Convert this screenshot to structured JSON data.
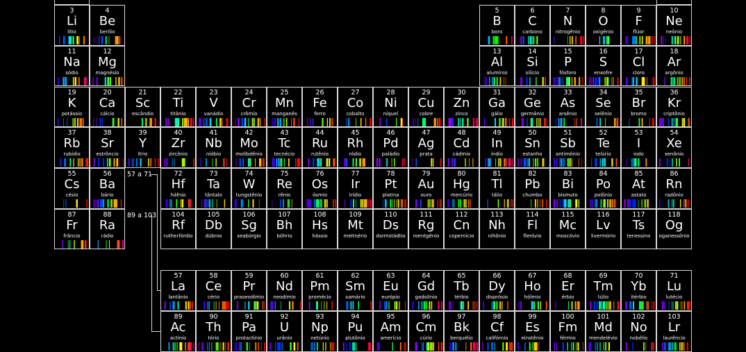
{
  "elements": [
    {
      "n": "3",
      "s": "Li",
      "name": "lítio",
      "c": 1,
      "r": 1,
      "hue": 0
    },
    {
      "n": "4",
      "s": "Be",
      "name": "berílio",
      "c": 2,
      "r": 1,
      "hue": 1
    },
    {
      "n": "5",
      "s": "B",
      "name": "boro",
      "c": 13,
      "r": 1,
      "hue": 2
    },
    {
      "n": "6",
      "s": "C",
      "name": "carbono",
      "c": 14,
      "r": 1,
      "hue": 3
    },
    {
      "n": "7",
      "s": "N",
      "name": "nitrogênio",
      "c": 15,
      "r": 1,
      "hue": 4
    },
    {
      "n": "8",
      "s": "O",
      "name": "oxigênio",
      "c": 16,
      "r": 1,
      "hue": 5
    },
    {
      "n": "9",
      "s": "F",
      "name": "flúor",
      "c": 17,
      "r": 1,
      "hue": 6
    },
    {
      "n": "10",
      "s": "Ne",
      "name": "neônio",
      "c": 18,
      "r": 1,
      "hue": 7
    },
    {
      "n": "11",
      "s": "Na",
      "name": "sódio",
      "c": 1,
      "r": 2,
      "hue": 2
    },
    {
      "n": "12",
      "s": "Mg",
      "name": "magnésio",
      "c": 2,
      "r": 2,
      "hue": 3
    },
    {
      "n": "13",
      "s": "Al",
      "name": "alumínio",
      "c": 13,
      "r": 2,
      "hue": 4
    },
    {
      "n": "14",
      "s": "Si",
      "name": "silício",
      "c": 14,
      "r": 2,
      "hue": 5
    },
    {
      "n": "15",
      "s": "P",
      "name": "fósforo",
      "c": 15,
      "r": 2,
      "hue": 6
    },
    {
      "n": "16",
      "s": "S",
      "name": "enxofre",
      "c": 16,
      "r": 2,
      "hue": 7
    },
    {
      "n": "17",
      "s": "Cl",
      "name": "cloro",
      "c": 17,
      "r": 2,
      "hue": 0
    },
    {
      "n": "18",
      "s": "Ar",
      "name": "argônio",
      "c": 18,
      "r": 2,
      "hue": 1
    },
    {
      "n": "19",
      "s": "K",
      "name": "potássio",
      "c": 1,
      "r": 3,
      "hue": 4
    },
    {
      "n": "20",
      "s": "Ca",
      "name": "cálcio",
      "c": 2,
      "r": 3,
      "hue": 5
    },
    {
      "n": "21",
      "s": "Sc",
      "name": "escândio",
      "c": 3,
      "r": 3,
      "hue": 6
    },
    {
      "n": "22",
      "s": "Ti",
      "name": "titânio",
      "c": 4,
      "r": 3,
      "hue": 7
    },
    {
      "n": "23",
      "s": "V",
      "name": "vanádio",
      "c": 5,
      "r": 3,
      "hue": 0
    },
    {
      "n": "24",
      "s": "Cr",
      "name": "crômio",
      "c": 6,
      "r": 3,
      "hue": 1
    },
    {
      "n": "25",
      "s": "Mn",
      "name": "manganês",
      "c": 7,
      "r": 3,
      "hue": 2
    },
    {
      "n": "26",
      "s": "Fe",
      "name": "ferro",
      "c": 8,
      "r": 3,
      "hue": 3
    },
    {
      "n": "27",
      "s": "Co",
      "name": "cobalto",
      "c": 9,
      "r": 3,
      "hue": 4
    },
    {
      "n": "28",
      "s": "Ni",
      "name": "níquel",
      "c": 10,
      "r": 3,
      "hue": 5
    },
    {
      "n": "29",
      "s": "Cu",
      "name": "cobre",
      "c": 11,
      "r": 3,
      "hue": 6
    },
    {
      "n": "30",
      "s": "Zn",
      "name": "zinco",
      "c": 12,
      "r": 3,
      "hue": 7
    },
    {
      "n": "31",
      "s": "Ga",
      "name": "gálio",
      "c": 13,
      "r": 3,
      "hue": 0
    },
    {
      "n": "32",
      "s": "Ge",
      "name": "germânio",
      "c": 14,
      "r": 3,
      "hue": 1
    },
    {
      "n": "33",
      "s": "As",
      "name": "arsênio",
      "c": 15,
      "r": 3,
      "hue": 2
    },
    {
      "n": "34",
      "s": "Se",
      "name": "selênio",
      "c": 16,
      "r": 3,
      "hue": 3
    },
    {
      "n": "35",
      "s": "Br",
      "name": "bromo",
      "c": 17,
      "r": 3,
      "hue": 4
    },
    {
      "n": "36",
      "s": "Kr",
      "name": "criptônio",
      "c": 18,
      "r": 3,
      "hue": 5
    },
    {
      "n": "37",
      "s": "Rb",
      "name": "rubídio",
      "c": 1,
      "r": 4,
      "hue": 6
    },
    {
      "n": "38",
      "s": "Sr",
      "name": "estrôncio",
      "c": 2,
      "r": 4,
      "hue": 7
    },
    {
      "n": "39",
      "s": "Y",
      "name": "ítrio",
      "c": 3,
      "r": 4,
      "hue": 0
    },
    {
      "n": "40",
      "s": "Zr",
      "name": "zircônio",
      "c": 4,
      "r": 4,
      "hue": 1
    },
    {
      "n": "41",
      "s": "Nb",
      "name": "nióbio",
      "c": 5,
      "r": 4,
      "hue": 2
    },
    {
      "n": "42",
      "s": "Mo",
      "name": "molibdênio",
      "c": 6,
      "r": 4,
      "hue": 3
    },
    {
      "n": "43",
      "s": "Tc",
      "name": "tecnécio",
      "c": 7,
      "r": 4,
      "hue": 4
    },
    {
      "n": "44",
      "s": "Ru",
      "name": "rutênio",
      "c": 8,
      "r": 4,
      "hue": 5
    },
    {
      "n": "45",
      "s": "Rh",
      "name": "ródio",
      "c": 9,
      "r": 4,
      "hue": 6
    },
    {
      "n": "46",
      "s": "Pd",
      "name": "paládio",
      "c": 10,
      "r": 4,
      "hue": 7
    },
    {
      "n": "47",
      "s": "Ag",
      "name": "prata",
      "c": 11,
      "r": 4,
      "hue": 0
    },
    {
      "n": "48",
      "s": "Cd",
      "name": "cádmio",
      "c": 12,
      "r": 4,
      "hue": 1
    },
    {
      "n": "49",
      "s": "In",
      "name": "índio",
      "c": 13,
      "r": 4,
      "hue": 2
    },
    {
      "n": "50",
      "s": "Sn",
      "name": "estanho",
      "c": 14,
      "r": 4,
      "hue": 3
    },
    {
      "n": "51",
      "s": "Sb",
      "name": "antimônio",
      "c": 15,
      "r": 4,
      "hue": 4
    },
    {
      "n": "52",
      "s": "Te",
      "name": "telúrio",
      "c": 16,
      "r": 4,
      "hue": 5
    },
    {
      "n": "53",
      "s": "I",
      "name": "iodo",
      "c": 17,
      "r": 4,
      "hue": 6
    },
    {
      "n": "54",
      "s": "Xe",
      "name": "xenônio",
      "c": 18,
      "r": 4,
      "hue": 7
    },
    {
      "n": "55",
      "s": "Cs",
      "name": "césio",
      "c": 1,
      "r": 5,
      "hue": 0
    },
    {
      "n": "56",
      "s": "Ba",
      "name": "bário",
      "c": 2,
      "r": 5,
      "hue": 1
    },
    {
      "n": "72",
      "s": "Hf",
      "name": "háfnio",
      "c": 4,
      "r": 5,
      "hue": 2
    },
    {
      "n": "73",
      "s": "Ta",
      "name": "tântalo",
      "c": 5,
      "r": 5,
      "hue": 3
    },
    {
      "n": "74",
      "s": "W",
      "name": "tungstênio",
      "c": 6,
      "r": 5,
      "hue": 4
    },
    {
      "n": "75",
      "s": "Re",
      "name": "rênio",
      "c": 7,
      "r": 5,
      "hue": 5
    },
    {
      "n": "76",
      "s": "Os",
      "name": "ósmio",
      "c": 8,
      "r": 5,
      "hue": 6
    },
    {
      "n": "77",
      "s": "Ir",
      "name": "irídio",
      "c": 9,
      "r": 5,
      "hue": 7
    },
    {
      "n": "78",
      "s": "Pt",
      "name": "platina",
      "c": 10,
      "r": 5,
      "hue": 0
    },
    {
      "n": "79",
      "s": "Au",
      "name": "ouro",
      "c": 11,
      "r": 5,
      "hue": 1
    },
    {
      "n": "80",
      "s": "Hg",
      "name": "mercúrio",
      "c": 12,
      "r": 5,
      "hue": 2
    },
    {
      "n": "81",
      "s": "Tl",
      "name": "tálio",
      "c": 13,
      "r": 5,
      "hue": 3
    },
    {
      "n": "82",
      "s": "Pb",
      "name": "chumbo",
      "c": 14,
      "r": 5,
      "hue": 4
    },
    {
      "n": "83",
      "s": "Bi",
      "name": "bismuto",
      "c": 15,
      "r": 5,
      "hue": 5
    },
    {
      "n": "84",
      "s": "Po",
      "name": "polônio",
      "c": 16,
      "r": 5,
      "hue": 6
    },
    {
      "n": "85",
      "s": "At",
      "name": "astato",
      "c": 17,
      "r": 5,
      "hue": 7
    },
    {
      "n": "86",
      "s": "Rn",
      "name": "radônio",
      "c": 18,
      "r": 5,
      "hue": 0
    },
    {
      "n": "87",
      "s": "Fr",
      "name": "frâncio",
      "c": 1,
      "r": 6,
      "hue": 1
    },
    {
      "n": "88",
      "s": "Ra",
      "name": "rádio",
      "c": 2,
      "r": 6,
      "hue": 2
    },
    {
      "n": "104",
      "s": "Rf",
      "name": "rutherfórdio",
      "c": 4,
      "r": 6,
      "hue": -1
    },
    {
      "n": "105",
      "s": "Db",
      "name": "dúbnio",
      "c": 5,
      "r": 6,
      "hue": -1
    },
    {
      "n": "106",
      "s": "Sg",
      "name": "seabórgio",
      "c": 6,
      "r": 6,
      "hue": -1
    },
    {
      "n": "107",
      "s": "Bh",
      "name": "bóhrio",
      "c": 7,
      "r": 6,
      "hue": -1
    },
    {
      "n": "108",
      "s": "Hs",
      "name": "hássio",
      "c": 8,
      "r": 6,
      "hue": -1
    },
    {
      "n": "109",
      "s": "Mt",
      "name": "meitnério",
      "c": 9,
      "r": 6,
      "hue": -1
    },
    {
      "n": "110",
      "s": "Ds",
      "name": "darmstádtio",
      "c": 10,
      "r": 6,
      "hue": -1
    },
    {
      "n": "111",
      "s": "Rg",
      "name": "roentgênio",
      "c": 11,
      "r": 6,
      "hue": -1
    },
    {
      "n": "112",
      "s": "Cn",
      "name": "copernício",
      "c": 12,
      "r": 6,
      "hue": -1
    },
    {
      "n": "113",
      "s": "Nh",
      "name": "nihônio",
      "c": 13,
      "r": 6,
      "hue": -1
    },
    {
      "n": "114",
      "s": "Fl",
      "name": "fleróvio",
      "c": 14,
      "r": 6,
      "hue": -1
    },
    {
      "n": "115",
      "s": "Mc",
      "name": "moscóvio",
      "c": 15,
      "r": 6,
      "hue": -1
    },
    {
      "n": "116",
      "s": "Lv",
      "name": "livermório",
      "c": 16,
      "r": 6,
      "hue": -1
    },
    {
      "n": "117",
      "s": "Ts",
      "name": "tenessino",
      "c": 17,
      "r": 6,
      "hue": -1
    },
    {
      "n": "118",
      "s": "Og",
      "name": "oganessônio",
      "c": 18,
      "r": 6,
      "hue": -1
    },
    {
      "n": "57",
      "s": "La",
      "name": "lantânio",
      "c": 4,
      "r": 8,
      "hue": 3
    },
    {
      "n": "58",
      "s": "Ce",
      "name": "cério",
      "c": 5,
      "r": 8,
      "hue": 4
    },
    {
      "n": "59",
      "s": "Pr",
      "name": "praseodímio",
      "c": 6,
      "r": 8,
      "hue": 5
    },
    {
      "n": "60",
      "s": "Nd",
      "name": "neodímio",
      "c": 7,
      "r": 8,
      "hue": 6
    },
    {
      "n": "61",
      "s": "Pm",
      "name": "promécio",
      "c": 8,
      "r": 8,
      "hue": 7
    },
    {
      "n": "62",
      "s": "Sm",
      "name": "samário",
      "c": 9,
      "r": 8,
      "hue": 0
    },
    {
      "n": "63",
      "s": "Eu",
      "name": "európio",
      "c": 10,
      "r": 8,
      "hue": 1
    },
    {
      "n": "64",
      "s": "Gd",
      "name": "gadolínio",
      "c": 11,
      "r": 8,
      "hue": 2
    },
    {
      "n": "65",
      "s": "Tb",
      "name": "térbio",
      "c": 12,
      "r": 8,
      "hue": 3
    },
    {
      "n": "66",
      "s": "Dy",
      "name": "disprósio",
      "c": 13,
      "r": 8,
      "hue": 4
    },
    {
      "n": "67",
      "s": "Ho",
      "name": "hólmio",
      "c": 14,
      "r": 8,
      "hue": 5
    },
    {
      "n": "68",
      "s": "Er",
      "name": "érbio",
      "c": 15,
      "r": 8,
      "hue": 6
    },
    {
      "n": "69",
      "s": "Tm",
      "name": "túlio",
      "c": 16,
      "r": 8,
      "hue": 7
    },
    {
      "n": "70",
      "s": "Yb",
      "name": "itérbio",
      "c": 17,
      "r": 8,
      "hue": 0
    },
    {
      "n": "71",
      "s": "Lu",
      "name": "lutécio",
      "c": 18,
      "r": 8,
      "hue": 1
    },
    {
      "n": "89",
      "s": "Ac",
      "name": "actínio",
      "c": 4,
      "r": 9,
      "hue": 2
    },
    {
      "n": "90",
      "s": "Th",
      "name": "tório",
      "c": 5,
      "r": 9,
      "hue": 3
    },
    {
      "n": "91",
      "s": "Pa",
      "name": "protactínio",
      "c": 6,
      "r": 9,
      "hue": 4
    },
    {
      "n": "92",
      "s": "U",
      "name": "urânio",
      "c": 7,
      "r": 9,
      "hue": 5
    },
    {
      "n": "93",
      "s": "Np",
      "name": "netúnio",
      "c": 8,
      "r": 9,
      "hue": 6
    },
    {
      "n": "94",
      "s": "Pu",
      "name": "plutônio",
      "c": 9,
      "r": 9,
      "hue": 7
    },
    {
      "n": "95",
      "s": "Am",
      "name": "amerício",
      "c": 10,
      "r": 9,
      "hue": 0
    },
    {
      "n": "96",
      "s": "Cm",
      "name": "cúrio",
      "c": 11,
      "r": 9,
      "hue": 1
    },
    {
      "n": "97",
      "s": "Bk",
      "name": "berquélio",
      "c": 12,
      "r": 9,
      "hue": 2
    },
    {
      "n": "98",
      "s": "Cf",
      "name": "califórnio",
      "c": 13,
      "r": 9,
      "hue": 3
    },
    {
      "n": "99",
      "s": "Es",
      "name": "einstênio",
      "c": 14,
      "r": 9,
      "hue": 4
    },
    {
      "n": "100",
      "s": "Fm",
      "name": "férmio",
      "c": 15,
      "r": 9,
      "hue": 5
    },
    {
      "n": "101",
      "s": "Md",
      "name": "mendelévio",
      "c": 16,
      "r": 9,
      "hue": 6
    },
    {
      "n": "102",
      "s": "No",
      "name": "nobélio",
      "c": 17,
      "r": 9,
      "hue": 7
    },
    {
      "n": "103",
      "s": "Lr",
      "name": "laurêncio",
      "c": 18,
      "r": 9,
      "hue": 0
    }
  ],
  "series_labels": {
    "lanthanides": "57 a 71",
    "actinides": "89 a 103"
  },
  "colors": {
    "background": "#000000",
    "border": "#d8d8d8",
    "text": "#ffffff"
  }
}
